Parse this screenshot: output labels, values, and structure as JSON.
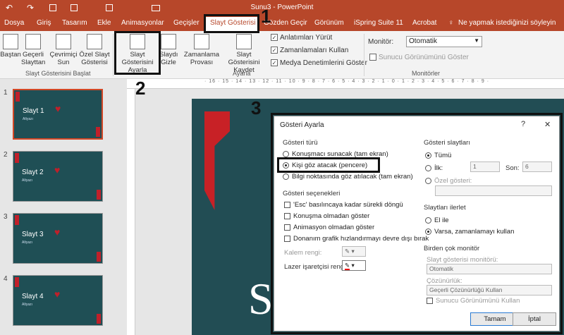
{
  "titlebar": {
    "title": "Sunu3 - PowerPoint",
    "undo": "↶",
    "redo": "↷"
  },
  "tabs": [
    "Dosya",
    "Giriş",
    "Tasarım",
    "Ekle",
    "Animasyonlar",
    "Geçişler",
    "Slayt Gösterisi",
    "Gözden Geçir",
    "Görünüm",
    "iSpring Suite 11",
    "Acrobat",
    "Ne yapmak istediğinizi söyleyin"
  ],
  "ribbon": {
    "buttons": [
      "Baştan",
      "Geçerli Slayttan",
      "Çevrimiçi Sun",
      "Özel Slayt Gösterisi",
      "Slayt Gösterisini Ayarla",
      "Slaydı Gizle",
      "Zamanlama Provası",
      "Slayt Gösterisini Kaydet"
    ],
    "checks": [
      {
        "label": "Anlatımları Yürüt",
        "on": true
      },
      {
        "label": "Zamanlamaları Kullan",
        "on": true
      },
      {
        "label": "Medya Denetimlerini Göster",
        "on": true
      }
    ],
    "monitor_label": "Monitör:",
    "monitor_value": "Otomatik",
    "presenter": "Sunucu Görünümünü Göster",
    "groups": [
      "Slayt Gösterisini Başlat",
      "Ayarla",
      "Monitörler"
    ]
  },
  "slides": [
    {
      "num": "1",
      "title": "Slayt 1",
      "sub": "Altyazı"
    },
    {
      "num": "2",
      "title": "Slayt 2",
      "sub": "Altyazı"
    },
    {
      "num": "3",
      "title": "Slayt 3",
      "sub": "Altyazı"
    },
    {
      "num": "4",
      "title": "Slayt 4",
      "sub": "Altyazı"
    }
  ],
  "ruler": "· 16 · 15 · 14 · 13 · 12 · 11 · 10 · 9 · 8 · 7 · 6 · 5 · 4 · 3 · 2 · 1 · 0 · 1 · 2 · 3 · 4 · 5 · 6 · 7 · 8 · 9 ·",
  "slide_main_text": "S",
  "annotations": [
    "1",
    "2",
    "3"
  ],
  "dialog": {
    "title": "Gösteri Ayarla",
    "help": "?",
    "close": "✕",
    "show_type": {
      "label": "Gösteri türü",
      "options": [
        "Konuşmacı sunacak (tam ekran)",
        "Kişi göz atacak (pencere)",
        "Bilgi noktasında göz atılacak (tam ekran)"
      ],
      "selected": 1
    },
    "options": {
      "label": "Gösteri seçenekleri",
      "items": [
        "'Esc' basılıncaya kadar sürekli döngü",
        "Konuşma olmadan göster",
        "Animasyon olmadan göster",
        "Donanım grafik hızlandırmayı devre dışı bırak"
      ],
      "pen_color": "Kalem rengi:",
      "laser_color": "Lazer işaretçisi rengi:"
    },
    "show_slides": {
      "label": "Gösteri slaytları",
      "all": "Tümü",
      "from": "İlk:",
      "from_val": "1",
      "to": "Son:",
      "to_val": "6",
      "custom": "Özel gösteri:"
    },
    "advance": {
      "label": "Slaytları ilerlet",
      "manual": "El ile",
      "timing": "Varsa, zamanlamayı kullan"
    },
    "multi": {
      "label": "Birden çok monitör",
      "monitor_label": "Slayt gösterisi monitörü:",
      "monitor_val": "Otomatik",
      "res_label": "Çözünürlük:",
      "res_val": "Geçerli Çözünürlüğü Kullan",
      "presenter": "Sunucu Görünümünü Kullan"
    },
    "ok": "Tamam",
    "cancel": "İptal"
  },
  "colors": {
    "brand": "#b7472a",
    "slide_bg": "#224d54",
    "accent_red": "#c82126"
  }
}
